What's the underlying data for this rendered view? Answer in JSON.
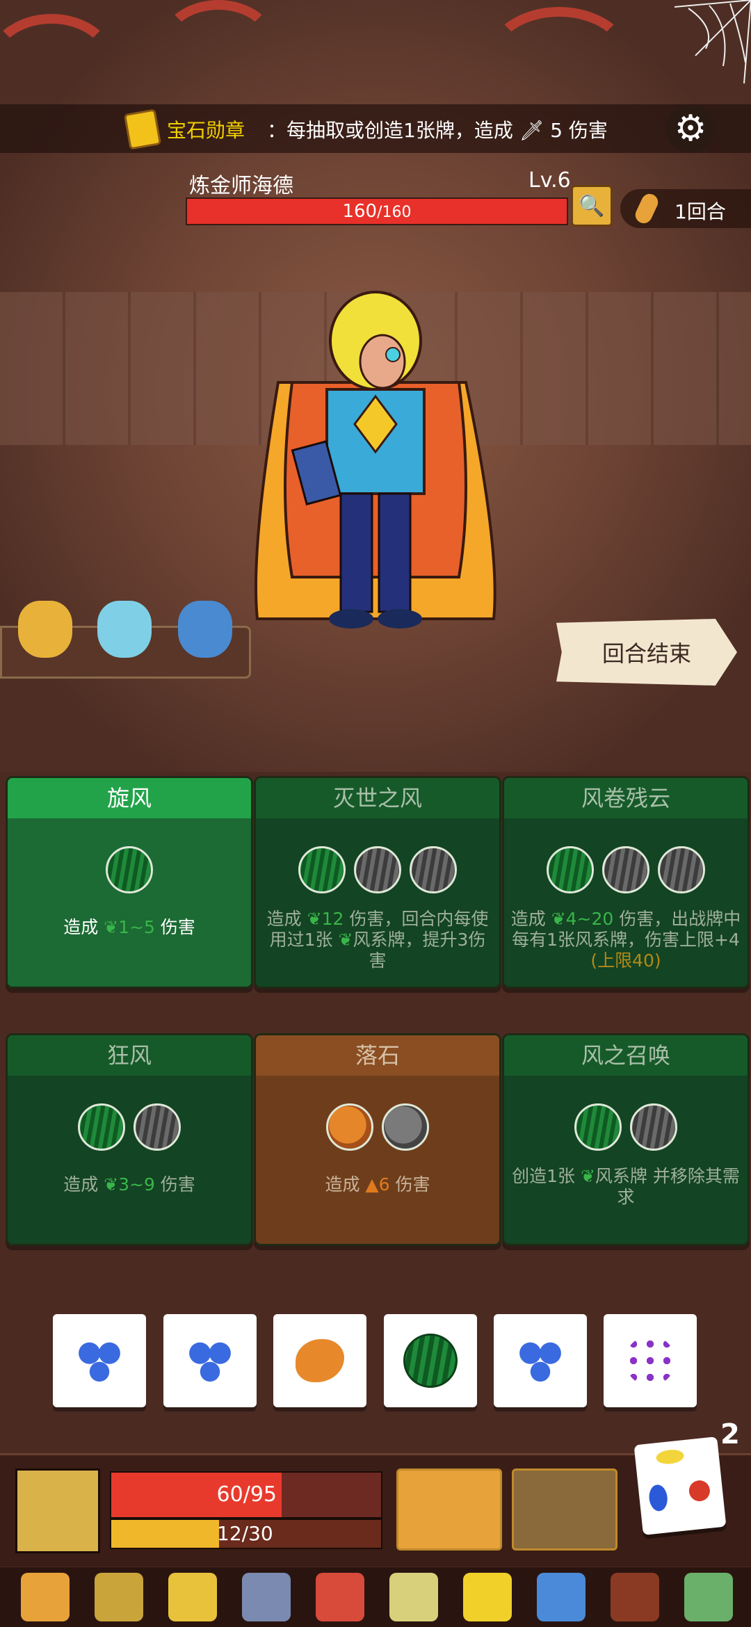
{
  "banner": {
    "medal_title": "宝石勋章",
    "medal_desc": "：每抽取或创造1张牌，造成",
    "damage_value": "5",
    "damage_suffix": "伤害"
  },
  "enemy": {
    "name": "炼金师海德",
    "level": "Lv.6",
    "hp_current": "160",
    "hp_max": "/160",
    "hp_fraction": 1.0
  },
  "turn": {
    "label": "1回合"
  },
  "end_turn": {
    "label": "回合结束"
  },
  "cards": [
    {
      "title": "旋风",
      "pre": "造成 ",
      "value": "1~5",
      "post": " 伤害",
      "extra": "",
      "state": "active"
    },
    {
      "title": "灭世之风",
      "pre": "造成 ",
      "value": "12",
      "post": " 伤害，回合内每使用过1张 ",
      "value2": "风系牌，提升3伤害",
      "state": "inactive"
    },
    {
      "title": "风卷残云",
      "pre": "造成 ",
      "value": "4~20",
      "post": " 伤害，出战牌中每有1张风系牌，伤害上限+4 ",
      "limit": "(上限40)",
      "state": "inactive"
    },
    {
      "title": "狂风",
      "pre": "造成 ",
      "value": "3~9",
      "post": " 伤害",
      "state": "inactive"
    },
    {
      "title": "落石",
      "pre": "造成 ",
      "value": "6",
      "post": " 伤害",
      "state": "earth"
    },
    {
      "title": "风之召唤",
      "pre": "创造1张 ",
      "value": "风系牌",
      "post": " 并移除其需求",
      "state": "inactive"
    }
  ],
  "dice": [
    "blueberry",
    "blueberry",
    "orange",
    "melon",
    "blueberry",
    "grape"
  ],
  "dice_remaining": "2",
  "player": {
    "hp_text": "60/95",
    "hp_fraction": 0.632,
    "xp_text": "12/30",
    "xp_fraction": 0.4
  },
  "relics": [
    "tribal-mask-icon",
    "acorn-icon",
    "golden-helmet-icon",
    "axe-icon",
    "sun-mask-icon",
    "feather-icon",
    "golden-block-icon",
    "dagger-icon",
    "shield-icon",
    "green-skull-icon"
  ],
  "colors": {
    "hp": "#e83a2c",
    "xp": "#f0b72a",
    "wind": "#39b54a",
    "earth": "#e07a1c"
  }
}
